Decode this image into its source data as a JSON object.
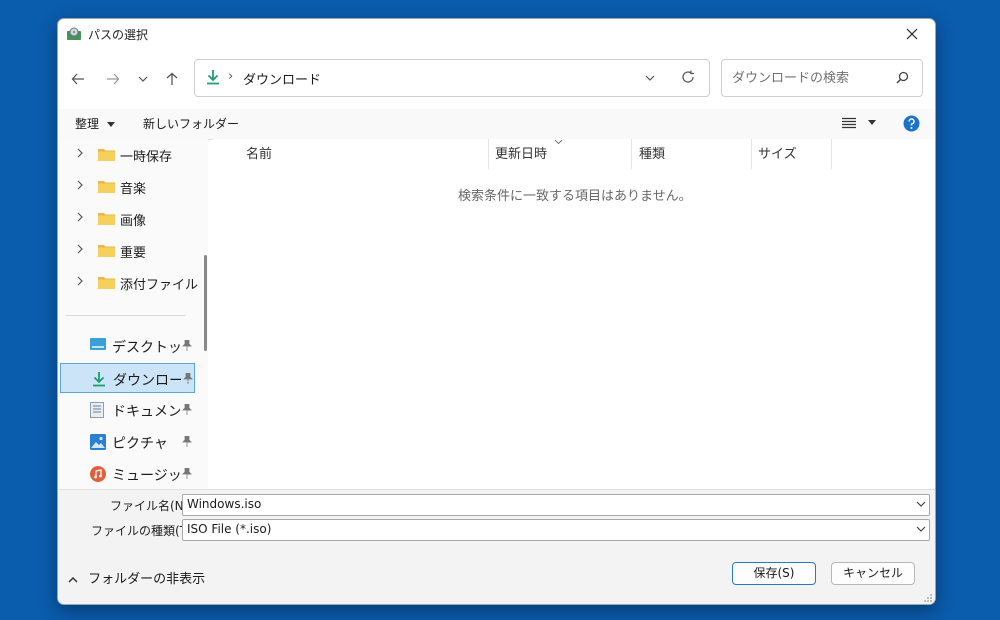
{
  "window": {
    "title": "パスの選択",
    "icon": "disc-burn-app-icon"
  },
  "navigation": {
    "back_icon": "arrow-left-icon",
    "forward_icon": "arrow-right-icon",
    "recent_icon": "chevron-down-icon",
    "up_icon": "arrow-up-icon"
  },
  "address": {
    "location": "ダウンロード",
    "separator": "›"
  },
  "search": {
    "placeholder": "ダウンロードの検索"
  },
  "toolbar": {
    "organize_label": "整理",
    "new_folder_label": "新しいフォルダー"
  },
  "sidebar": {
    "folders": [
      {
        "label": "一時保存"
      },
      {
        "label": "音楽"
      },
      {
        "label": "画像"
      },
      {
        "label": "重要"
      },
      {
        "label": "添付ファイル"
      }
    ],
    "quick_access": [
      {
        "label": "デスクトップ",
        "icon": "desktop-icon"
      },
      {
        "label": "ダウンロード",
        "icon": "download-icon",
        "selected": true
      },
      {
        "label": "ドキュメント",
        "icon": "document-icon"
      },
      {
        "label": "ピクチャ",
        "icon": "picture-icon"
      },
      {
        "label": "ミュージック",
        "icon": "music-icon"
      }
    ]
  },
  "file_list": {
    "columns": [
      "名前",
      "更新日時",
      "種類",
      "サイズ"
    ],
    "empty_message": "検索条件に一致する項目はありません。"
  },
  "fields": {
    "filename_label": "ファイル名(N):",
    "filename_value": "Windows.iso",
    "filetype_label": "ファイルの種類(T):",
    "filetype_value": "ISO File (*.iso)"
  },
  "footer": {
    "hide_folders_label": "フォルダーの非表示",
    "save_label": "保存(S)",
    "cancel_label": "キャンセル"
  },
  "colors": {
    "desktop_bg": "#0a5cad",
    "selection_bg": "#cce4f7",
    "accent": "#2a78c4",
    "folder": "#f2c94c"
  }
}
